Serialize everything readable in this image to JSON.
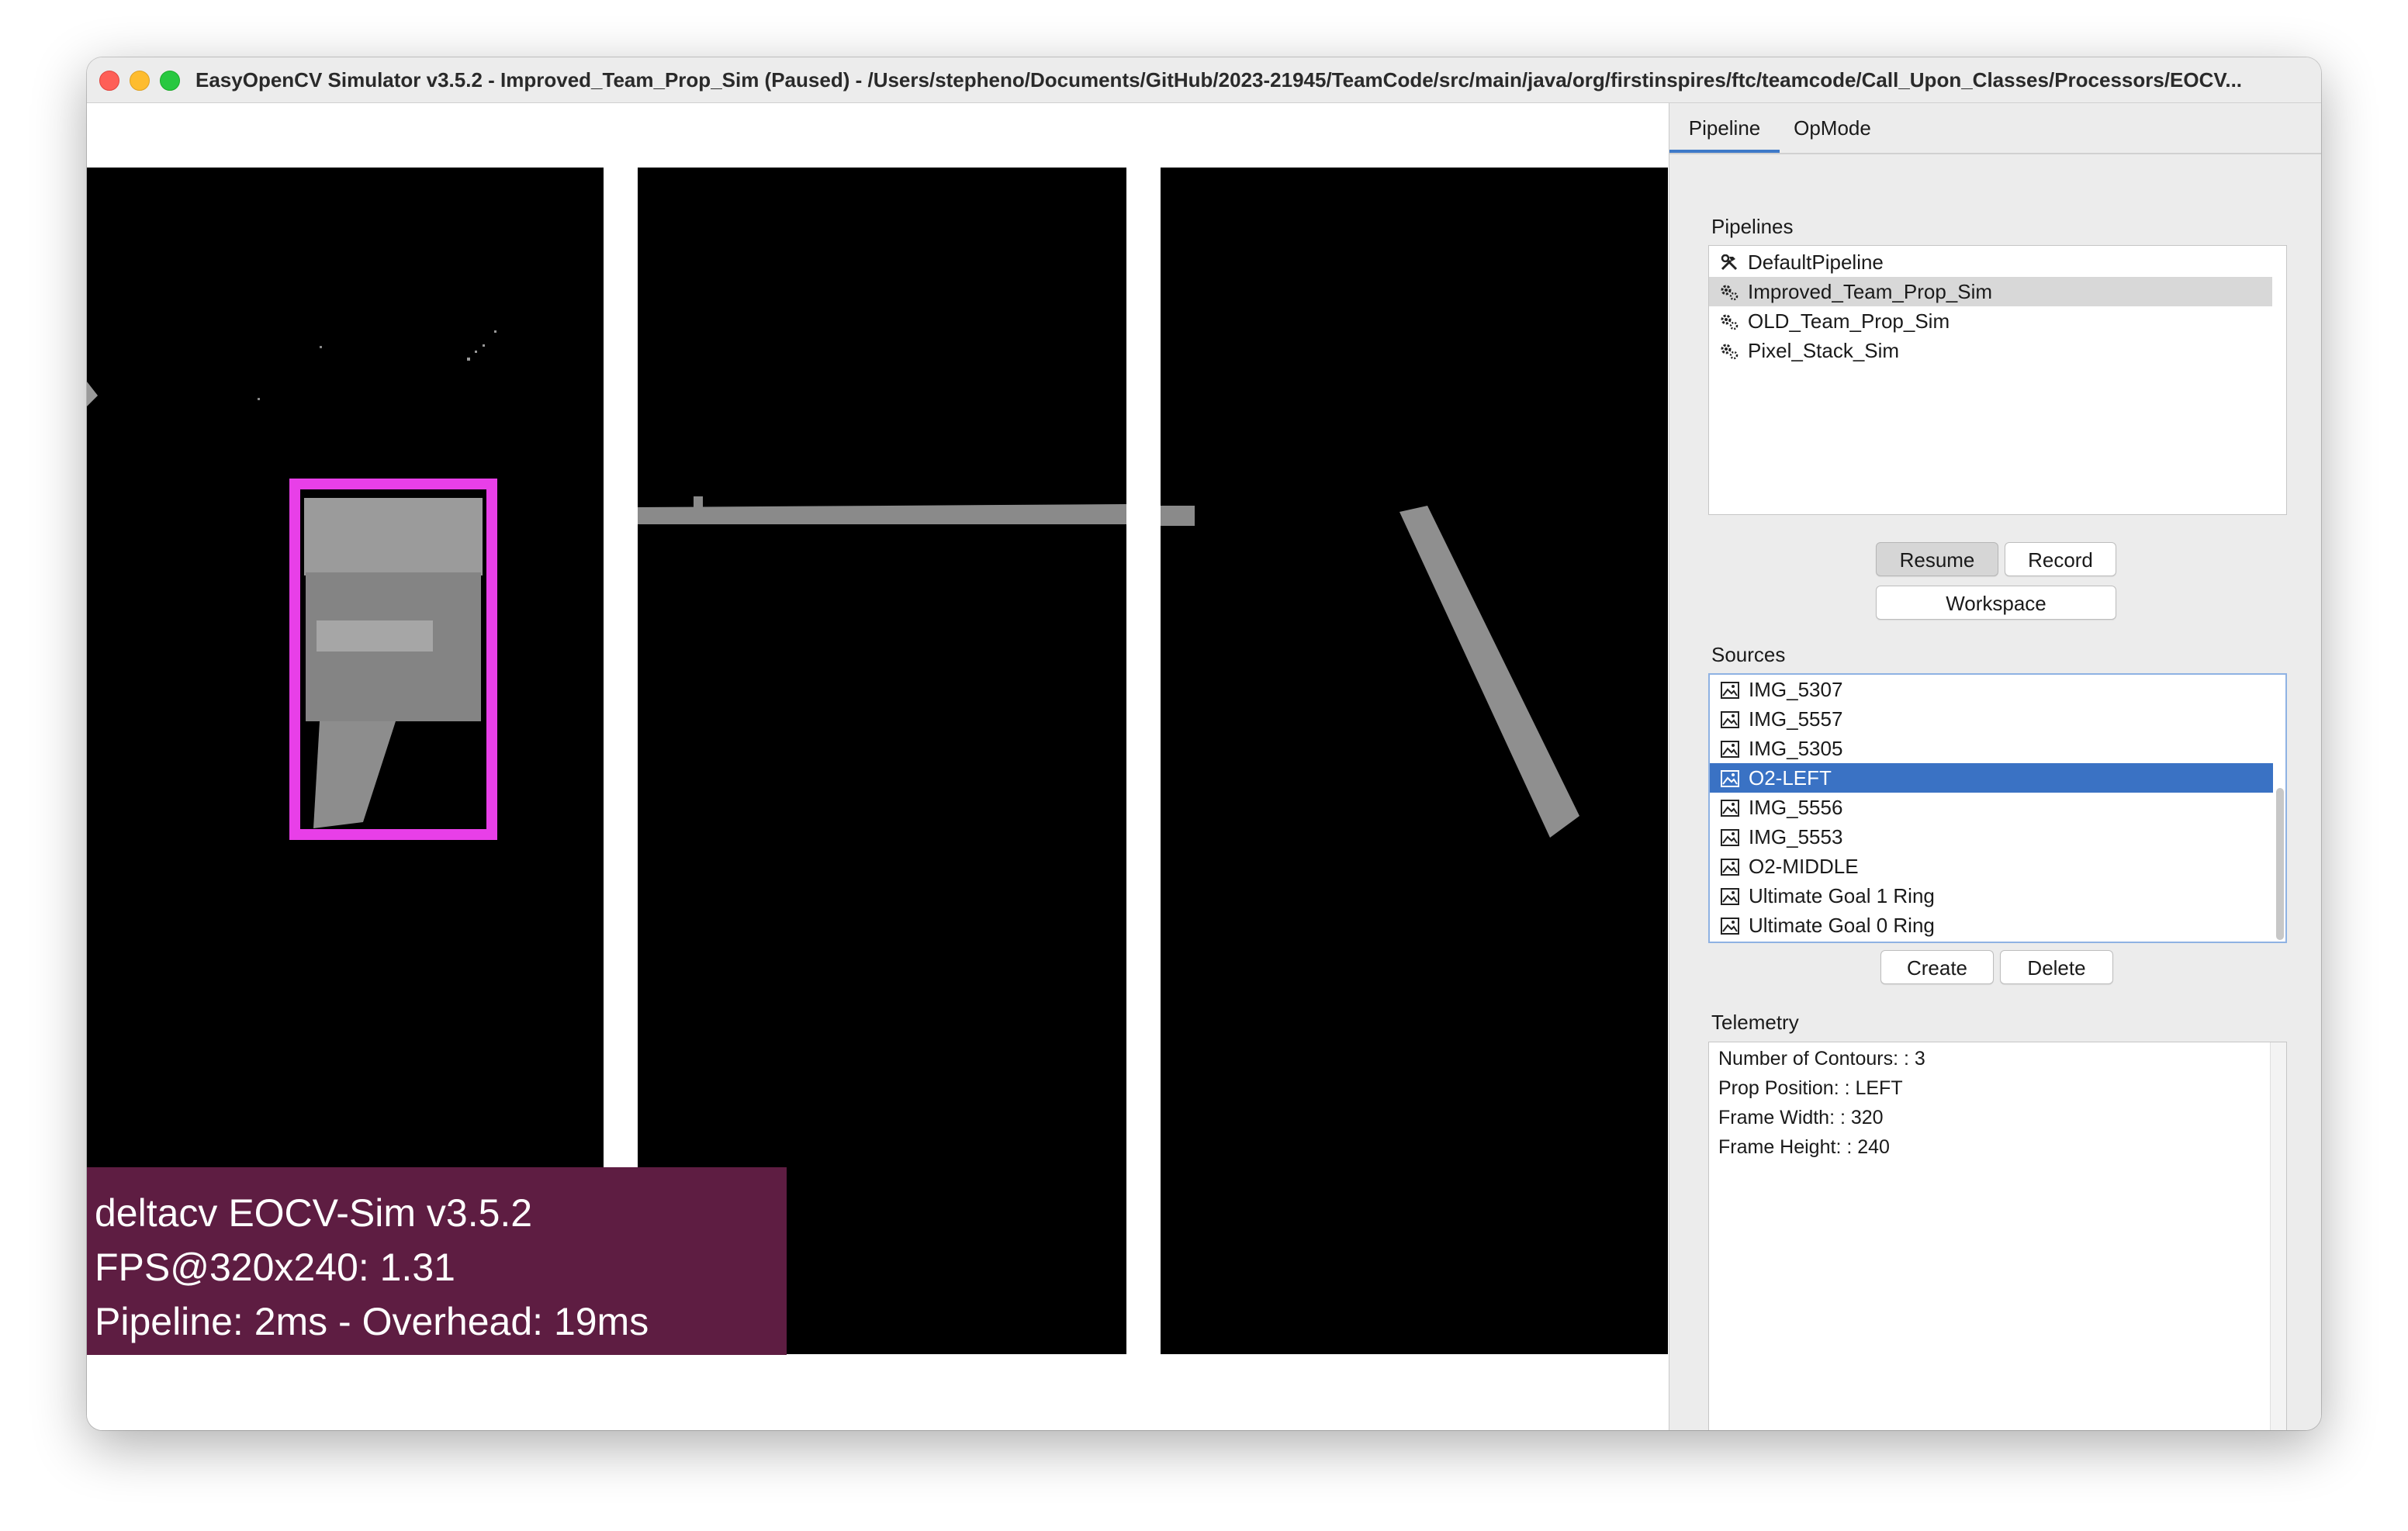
{
  "window": {
    "title": "EasyOpenCV Simulator v3.5.2 - Improved_Team_Prop_Sim (Paused) - /Users/stepheno/Documents/GitHub/2023-21945/TeamCode/src/main/java/org/firstinspires/ftc/teamcode/Call_Upon_Classes/Processors/EOCV..."
  },
  "overlay": {
    "line1": "deltacv EOCV-Sim v3.5.2",
    "line2": "FPS@320x240: 1.31",
    "line3": "Pipeline: 2ms - Overhead: 19ms"
  },
  "colors": {
    "detection_box": "#e83fe8",
    "overlay_bg": "#5e1d42",
    "selection_blue": "#3a72c4"
  },
  "tabs": [
    {
      "label": "Pipeline",
      "active": true
    },
    {
      "label": "OpMode",
      "active": false
    }
  ],
  "pipelines": {
    "label": "Pipelines",
    "items": [
      {
        "label": "DefaultPipeline",
        "icon": "hammer-wrench-icon"
      },
      {
        "label": "Improved_Team_Prop_Sim",
        "icon": "gears-icon",
        "selected": true
      },
      {
        "label": "OLD_Team_Prop_Sim",
        "icon": "gears-icon"
      },
      {
        "label": "Pixel_Stack_Sim",
        "icon": "gears-icon"
      }
    ]
  },
  "buttons": {
    "resume": "Resume",
    "record": "Record",
    "workspace": "Workspace",
    "create": "Create",
    "delete": "Delete"
  },
  "sources": {
    "label": "Sources",
    "items": [
      {
        "label": "IMG_5307",
        "icon": "image-icon"
      },
      {
        "label": "IMG_5557",
        "icon": "image-icon"
      },
      {
        "label": "IMG_5305",
        "icon": "image-icon"
      },
      {
        "label": "O2-LEFT",
        "icon": "image-icon",
        "selected": true
      },
      {
        "label": "IMG_5556",
        "icon": "image-icon"
      },
      {
        "label": "IMG_5553",
        "icon": "image-icon"
      },
      {
        "label": "O2-MIDDLE",
        "icon": "image-icon"
      },
      {
        "label": "Ultimate Goal 1 Ring",
        "icon": "image-icon"
      },
      {
        "label": "Ultimate Goal 0 Ring",
        "icon": "image-icon"
      }
    ]
  },
  "telemetry": {
    "label": "Telemetry",
    "lines": [
      "Number of Contours:  : 3",
      "Prop Position:  : LEFT",
      "Frame Width:  : 320",
      "Frame Height:  : 240"
    ]
  }
}
